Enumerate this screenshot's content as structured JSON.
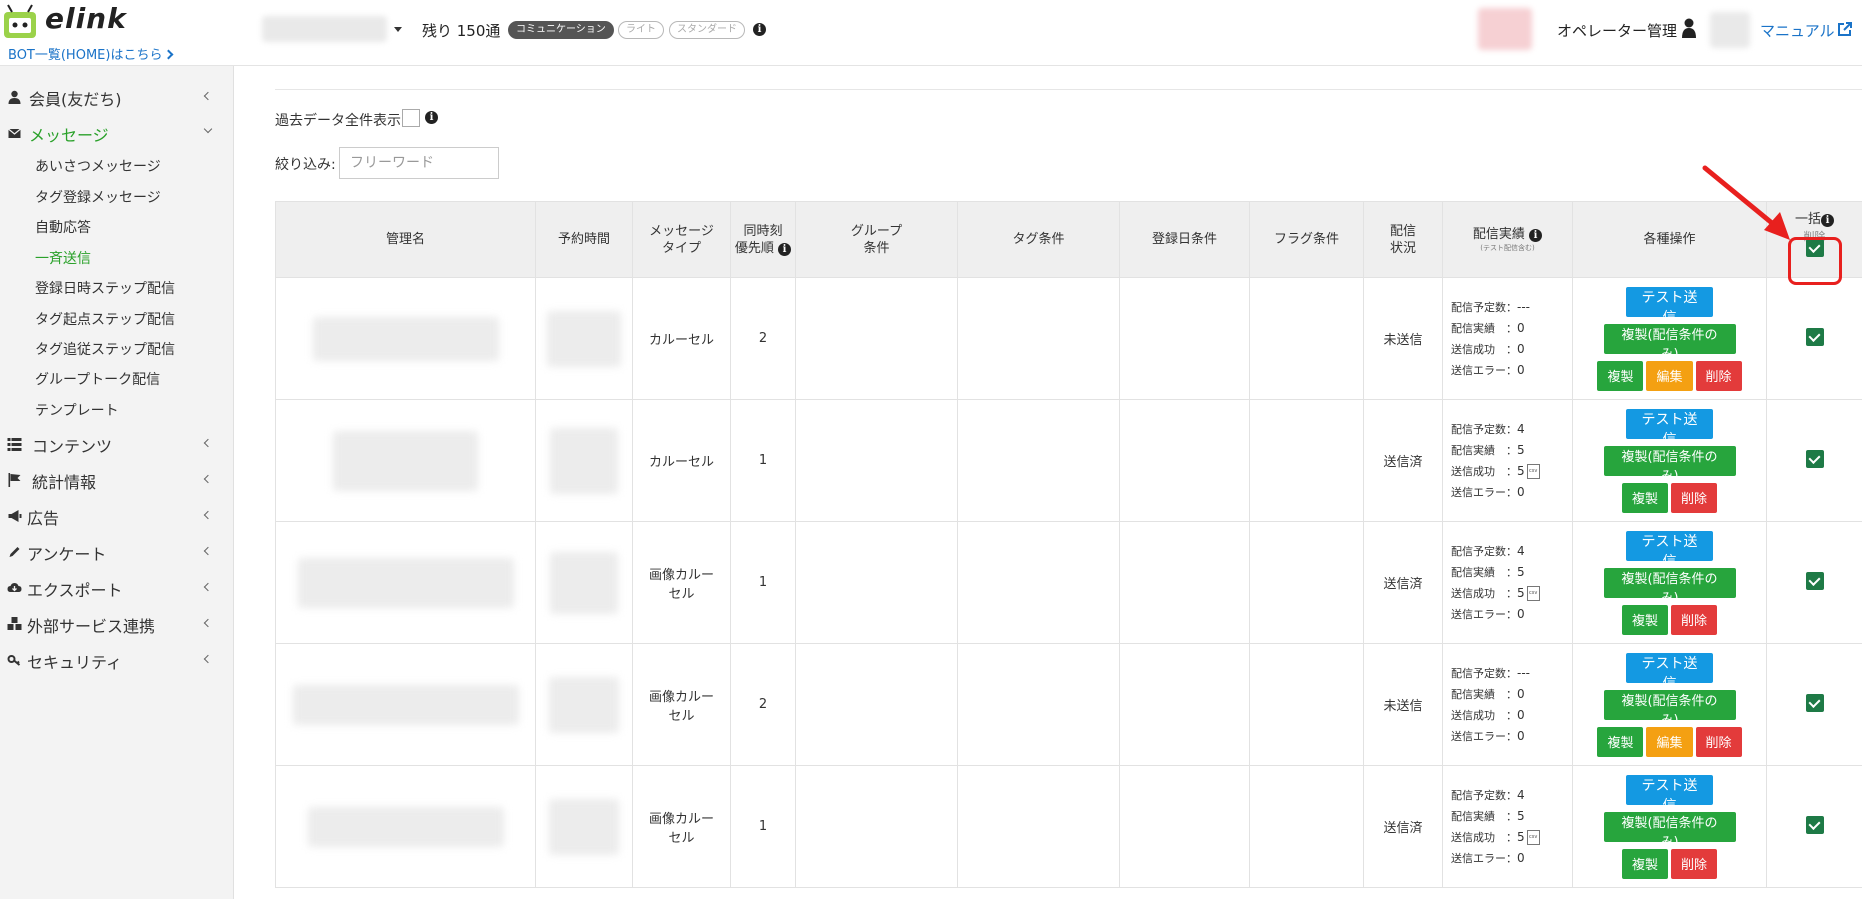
{
  "header": {
    "logo_text": "elink",
    "bot_link": "BOT一覧(HOME)はこちら",
    "remaining": "残り 150通",
    "plans": [
      "コミュニケーション",
      "ライト",
      "スタンダード"
    ],
    "operator": "オペレーター管理",
    "manual": "マニュアル"
  },
  "sidebar": {
    "items": [
      {
        "label": "会員(友だち)",
        "icon": "user-icon"
      },
      {
        "label": "メッセージ",
        "icon": "envelope-icon"
      },
      {
        "label": "コンテンツ",
        "icon": "list-icon"
      },
      {
        "label": "統計情報",
        "icon": "flag-icon"
      },
      {
        "label": "広告",
        "icon": "megaphone-icon"
      },
      {
        "label": "アンケート",
        "icon": "pencil-icon"
      },
      {
        "label": "エクスポート",
        "icon": "cloud-download-icon"
      },
      {
        "label": "外部サービス連携",
        "icon": "cubes-icon"
      },
      {
        "label": "セキュリティ",
        "icon": "key-icon"
      }
    ],
    "sub_items": [
      "あいさつメッセージ",
      "タグ登録メッセージ",
      "自動応答",
      "一斉送信",
      "登録日時ステップ配信",
      "タグ起点ステップ配信",
      "タグ追従ステップ配信",
      "グループトーク配信",
      "テンプレート"
    ]
  },
  "main": {
    "past_data_label": "過去データ全件表示",
    "filter_label": "絞り込み:",
    "filter_placeholder": "フリーワード"
  },
  "table": {
    "headers": {
      "name": "管理名",
      "time": "予約時間",
      "type1": "メッセージ",
      "type2": "タイプ",
      "prio1": "同時刻",
      "prio2": "優先順",
      "group1": "グループ",
      "group2": "条件",
      "tag": "タグ条件",
      "regdate": "登録日条件",
      "flag": "フラグ条件",
      "status1": "配信",
      "status2": "状況",
      "result": "配信実績",
      "result_note": "(テスト配信含む)",
      "ops": "各種操作",
      "bulk1": "一括",
      "bulk2": "削除"
    },
    "stat_labels": {
      "planned": "配信予定数：",
      "actual": "配信実績　：",
      "success": "送信成功　：",
      "error": "送信エラー："
    },
    "buttons": {
      "test": "テスト送信",
      "copy_cond": "複製(配信条件のみ)",
      "copy": "複製",
      "edit": "編集",
      "delete": "削除"
    },
    "csv_label": "csv",
    "rows": [
      {
        "type": "カルーセル",
        "priority": "2",
        "status": "未送信",
        "planned": "---",
        "actual": "0",
        "success": "0",
        "error": "0",
        "editable": true
      },
      {
        "type": "カルーセル",
        "priority": "1",
        "status": "送信済",
        "planned": "4",
        "actual": "5",
        "success": "5",
        "error": "0",
        "editable": false
      },
      {
        "type": "画像カルーセル",
        "priority": "1",
        "status": "送信済",
        "planned": "4",
        "actual": "5",
        "success": "5",
        "error": "0",
        "editable": false
      },
      {
        "type": "画像カルーセル",
        "priority": "2",
        "status": "未送信",
        "planned": "---",
        "actual": "0",
        "success": "0",
        "error": "0",
        "editable": true
      },
      {
        "type": "画像カルーセル",
        "priority": "1",
        "status": "送信済",
        "planned": "4",
        "actual": "5",
        "success": "5",
        "error": "0",
        "editable": false
      }
    ]
  }
}
